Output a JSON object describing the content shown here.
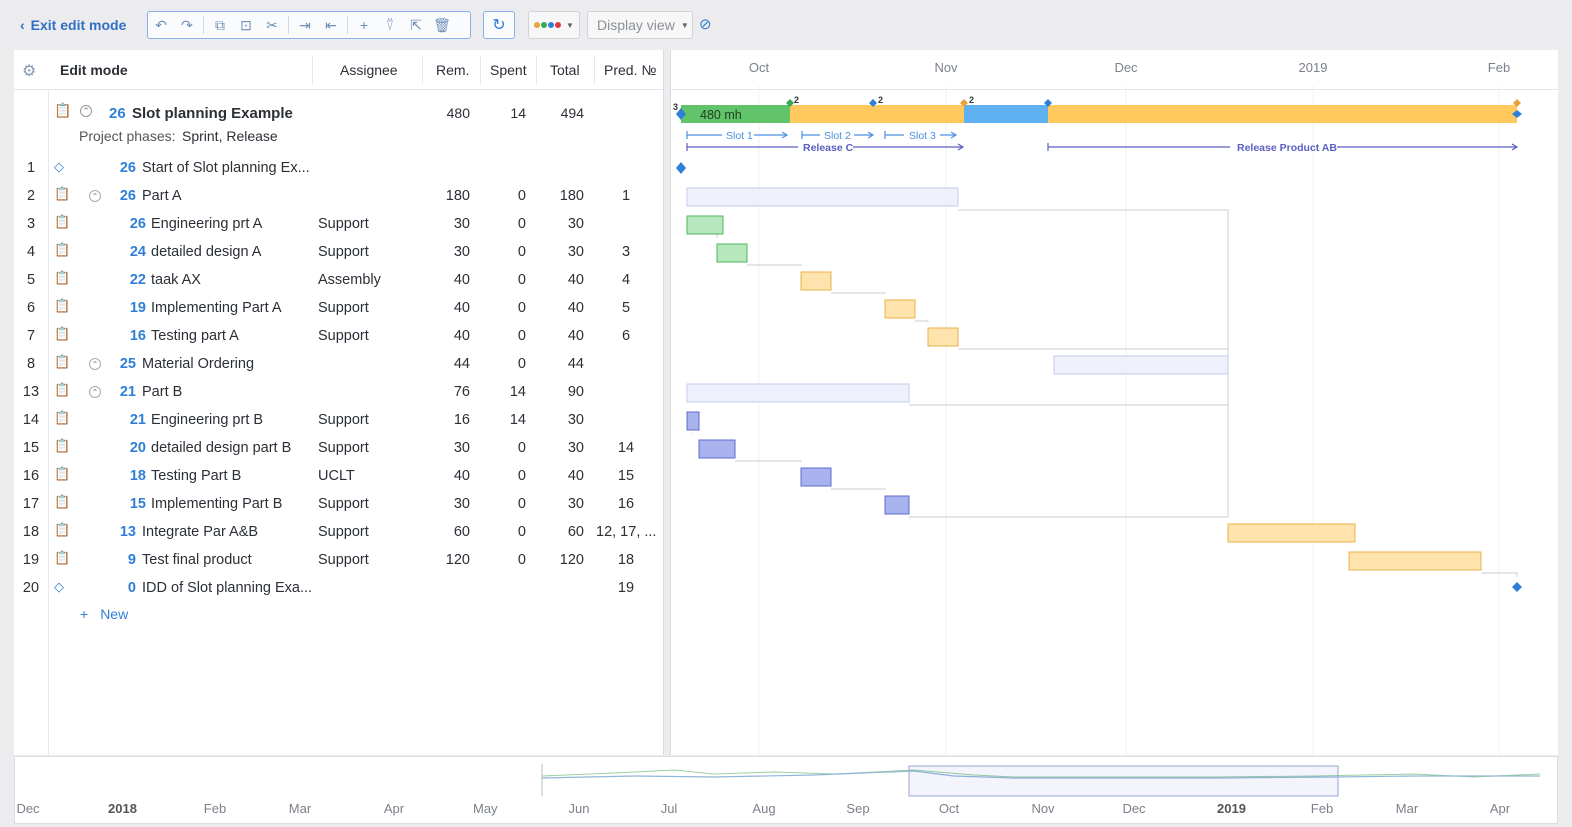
{
  "toolbar": {
    "exit_label": "Exit edit mode",
    "display_view": "Display view",
    "colors": [
      "#e8a23a",
      "#36a852",
      "#2f7fd8",
      "#d93d3d"
    ]
  },
  "grid": {
    "headers": {
      "title": "Edit mode",
      "assignee": "Assignee",
      "rem": "Rem.",
      "spent": "Spent",
      "total": "Total",
      "pred": "Pred. №"
    },
    "project": {
      "sid": "26",
      "name": "Slot planning Example",
      "rem": "480",
      "spent": "14",
      "total": "494",
      "phases_label": "Project phases:",
      "phases": "Sprint, Release"
    },
    "rows": [
      {
        "num": "1",
        "sid": "26",
        "name": "Start of Slot planning Ex...",
        "assignee": "",
        "rem": "",
        "spent": "",
        "total": "",
        "pred": ""
      },
      {
        "num": "2",
        "sid": "26",
        "name": "Part A",
        "assignee": "",
        "rem": "180",
        "spent": "0",
        "total": "180",
        "pred": "1"
      },
      {
        "num": "3",
        "sid": "26",
        "name": "Engineering prt A",
        "assignee": "Support",
        "rem": "30",
        "spent": "0",
        "total": "30",
        "pred": ""
      },
      {
        "num": "4",
        "sid": "24",
        "name": "detailed design A",
        "assignee": "Support",
        "rem": "30",
        "spent": "0",
        "total": "30",
        "pred": "3"
      },
      {
        "num": "5",
        "sid": "22",
        "name": "taak AX",
        "assignee": "Assembly",
        "rem": "40",
        "spent": "0",
        "total": "40",
        "pred": "4"
      },
      {
        "num": "6",
        "sid": "19",
        "name": "Implementing Part A",
        "assignee": "Support",
        "rem": "40",
        "spent": "0",
        "total": "40",
        "pred": "5"
      },
      {
        "num": "7",
        "sid": "16",
        "name": "Testing part A",
        "assignee": "Support",
        "rem": "40",
        "spent": "0",
        "total": "40",
        "pred": "6"
      },
      {
        "num": "8",
        "sid": "25",
        "name": "Material Ordering",
        "assignee": "",
        "rem": "44",
        "spent": "0",
        "total": "44",
        "pred": ""
      },
      {
        "num": "13",
        "sid": "21",
        "name": "Part B",
        "assignee": "",
        "rem": "76",
        "spent": "14",
        "total": "90",
        "pred": ""
      },
      {
        "num": "14",
        "sid": "21",
        "name": "Engineering prt B",
        "assignee": "Support",
        "rem": "16",
        "spent": "14",
        "total": "30",
        "pred": ""
      },
      {
        "num": "15",
        "sid": "20",
        "name": "detailed design part B",
        "assignee": "Support",
        "rem": "30",
        "spent": "0",
        "total": "30",
        "pred": "14"
      },
      {
        "num": "16",
        "sid": "18",
        "name": "Testing Part B",
        "assignee": "UCLT",
        "rem": "40",
        "spent": "0",
        "total": "40",
        "pred": "15"
      },
      {
        "num": "17",
        "sid": "15",
        "name": "Implementing Part B",
        "assignee": "Support",
        "rem": "30",
        "spent": "0",
        "total": "30",
        "pred": "16"
      },
      {
        "num": "18",
        "sid": "13",
        "name": "Integrate Par A&B",
        "assignee": "Support",
        "rem": "60",
        "spent": "0",
        "total": "60",
        "pred": "12, 17, ..."
      },
      {
        "num": "19",
        "sid": "9",
        "name": "Test final product",
        "assignee": "Support",
        "rem": "120",
        "spent": "0",
        "total": "120",
        "pred": "18"
      },
      {
        "num": "20",
        "sid": "0",
        "name": "IDD of Slot planning Exa...",
        "assignee": "",
        "rem": "",
        "spent": "",
        "total": "",
        "pred": "19"
      }
    ],
    "new_label": "New"
  },
  "gantt": {
    "months": [
      "Oct",
      "Nov",
      "Dec",
      "2019",
      "Feb"
    ],
    "phase_label": "480 mh",
    "phase_badges": [
      "3",
      "2",
      "2",
      "2"
    ],
    "slots": [
      "Slot 1",
      "Slot 2",
      "Slot 3"
    ],
    "releases": [
      "Release C",
      "Release Product AB"
    ]
  },
  "timeline": {
    "labels": [
      "Dec",
      "2018",
      "Feb",
      "Mar",
      "Apr",
      "May",
      "Jun",
      "Jul",
      "Aug",
      "Sep",
      "Oct",
      "Nov",
      "Dec",
      "2019",
      "Feb",
      "Mar",
      "Apr"
    ]
  }
}
